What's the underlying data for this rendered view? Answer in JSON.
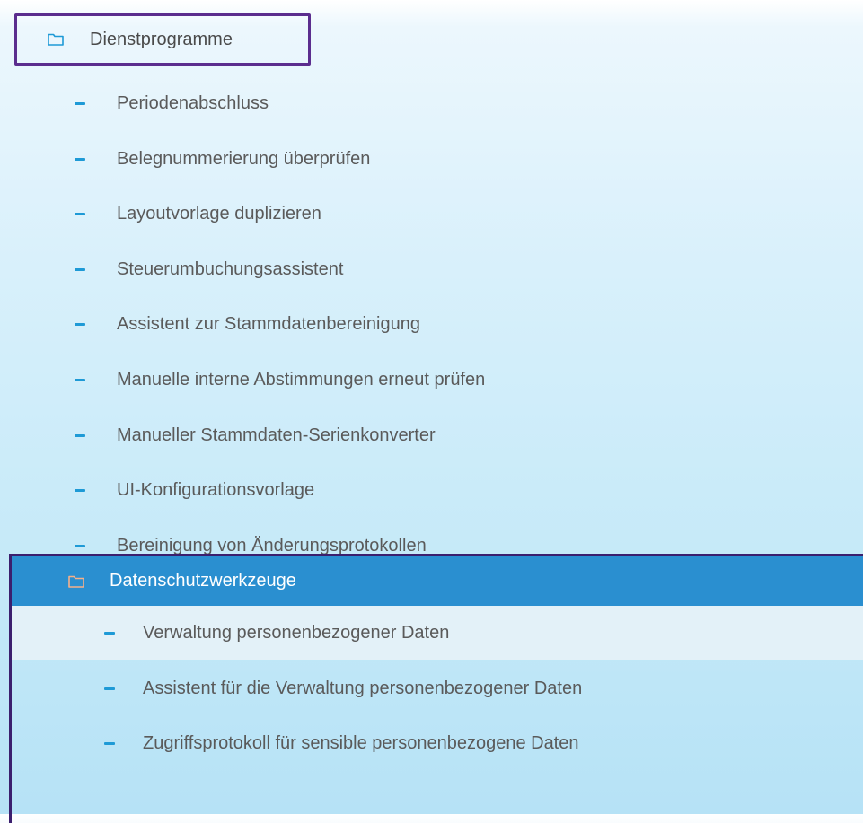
{
  "tree": {
    "root": {
      "label": "Dienstprogramme",
      "icon": "folder-icon"
    },
    "items": [
      {
        "label": "Periodenabschluss"
      },
      {
        "label": "Belegnummerierung überprüfen"
      },
      {
        "label": "Layoutvorlage duplizieren"
      },
      {
        "label": "Steuerumbuchungsassistent"
      },
      {
        "label": "Assistent zur Stammdatenbereinigung"
      },
      {
        "label": "Manuelle interne Abstimmungen erneut prüfen"
      },
      {
        "label": "Manueller Stammdaten-Serienkonverter"
      },
      {
        "label": "UI-Konfigurationsvorlage"
      },
      {
        "label": "Bereinigung von Änderungsprotokollen"
      }
    ],
    "section": {
      "label": "Datenschutzwerkzeuge",
      "icon": "folder-icon",
      "items": [
        {
          "label": "Verwaltung personenbezogener Daten"
        },
        {
          "label": "Assistent für die Verwaltung personenbezogener Daten"
        },
        {
          "label": "Zugriffsprotokoll für sensible personenbezogene Daten"
        }
      ]
    }
  },
  "colors": {
    "accent_dash": "#1e9ad6",
    "selected_header": "#2a8fd0",
    "highlight_border": "#5b2d8e",
    "section_folder_icon": "#f5b08a",
    "root_folder_icon": "#1e9ad6"
  }
}
